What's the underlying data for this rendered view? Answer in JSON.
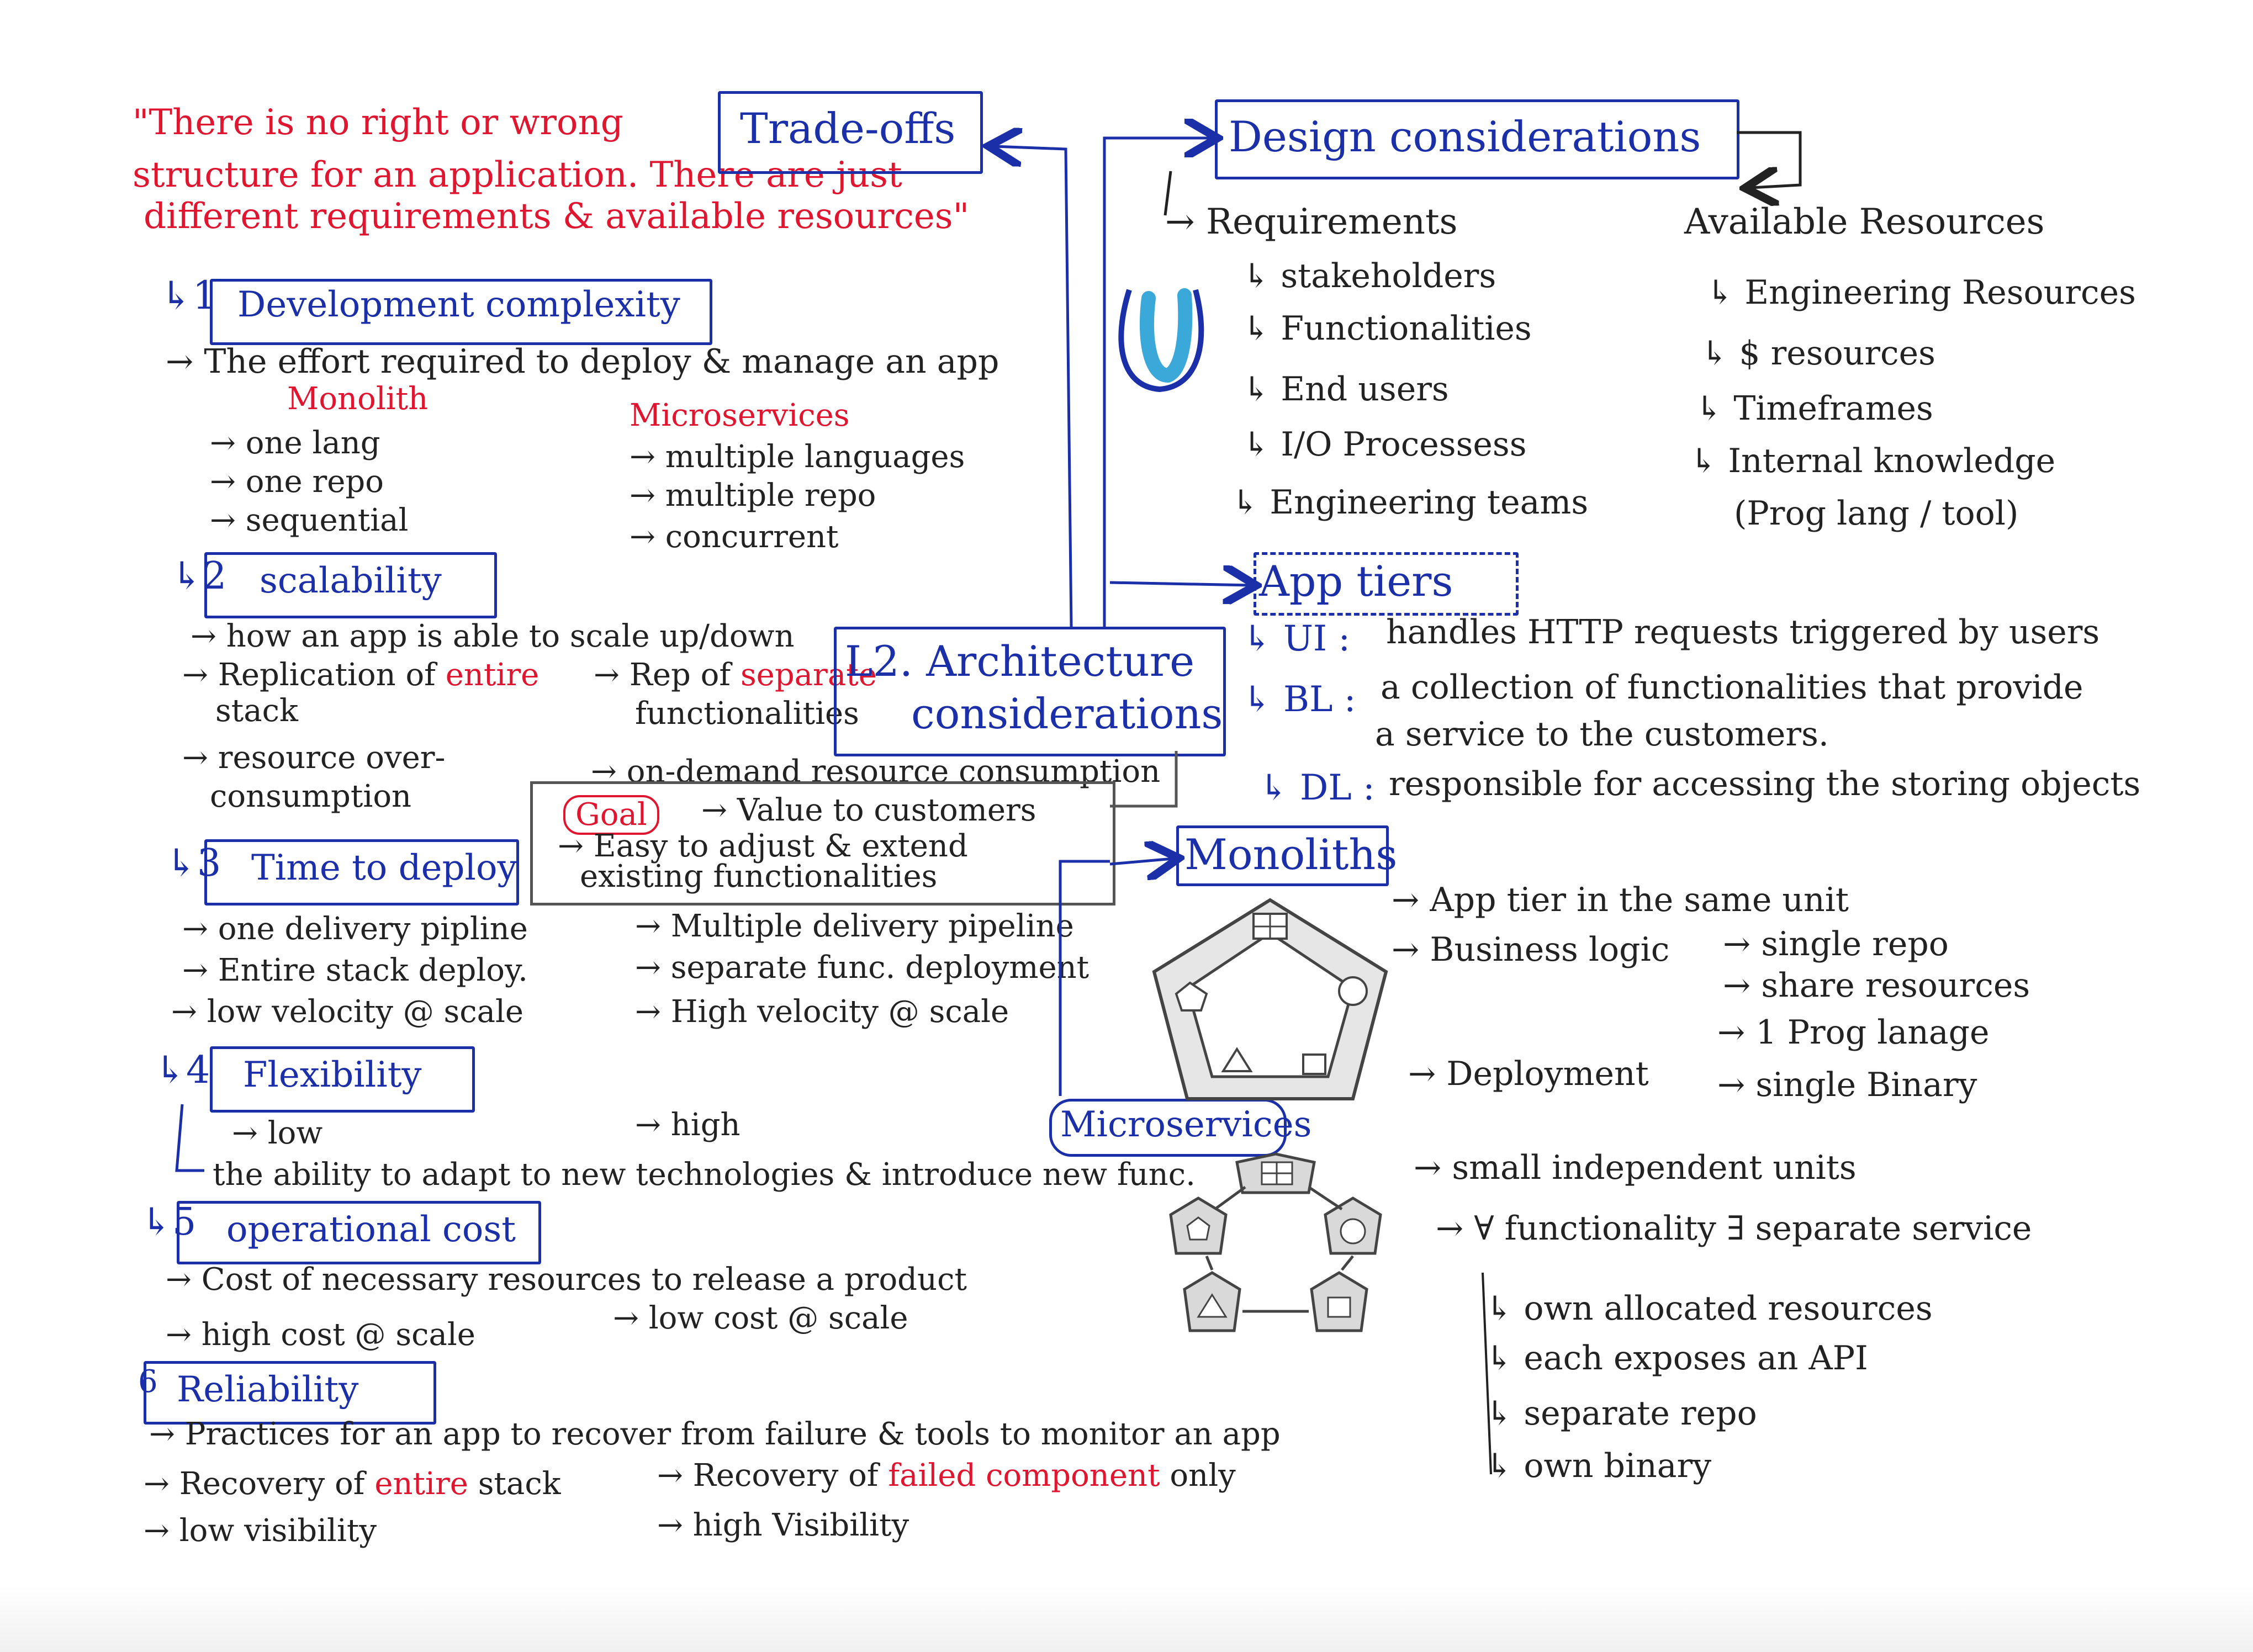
{
  "quote": {
    "line1": "\"There is no right or wrong",
    "line2": "structure for an application. There are just",
    "line3": "different requirements & available resources\""
  },
  "tradeoffs": {
    "label": "Trade-offs"
  },
  "center": {
    "line1": "L2. Architecture",
    "line2": "considerations"
  },
  "goal": {
    "label": "Goal",
    "item1": "→ Value to customers",
    "item2": "→ Easy to adjust & extend",
    "item3": "existing functionalities"
  },
  "dev_complexity": {
    "title": "Development complexity",
    "number": "1",
    "desc": "→ The effort required to deploy & manage an app",
    "monolith_head": "Monolith",
    "micro_head": "Microservices",
    "monolith": [
      "→ one lang",
      "→ one repo",
      "→ sequential"
    ],
    "micro": [
      "→ multiple languages",
      "→ multiple repo",
      "→ concurrent"
    ]
  },
  "scalability": {
    "title": "scalability",
    "number": "2",
    "desc": "→ how an app is able to scale up/down",
    "rep_left_1": "→ Replication of",
    "rep_left_red": "entire",
    "rep_left_2": "stack",
    "rep_right_1": "→ Rep of",
    "rep_right_red": "separate",
    "rep_right_2": "functionalities",
    "over_1": "→ resource over-",
    "over_2": "consumption",
    "ondemand": "→ on-demand resource consumption"
  },
  "time_to_deploy": {
    "title": "Time to deploy",
    "number": "3",
    "left": [
      "→ one delivery pipline",
      "→ Entire stack deploy.",
      "→ low velocity @ scale"
    ],
    "right": [
      "→ Multiple delivery pipeline",
      "→ separate func. deployment",
      "→ High velocity @ scale"
    ]
  },
  "flexibility": {
    "title": "Flexibility",
    "number": "4",
    "low": "→ low",
    "high": "→ high",
    "desc": "the ability to adapt to new technologies & introduce new func."
  },
  "operational_cost": {
    "title": "operational cost",
    "number": "5",
    "desc": "→ Cost of necessary resources to release a product",
    "left": "→ high cost @ scale",
    "right": "→ low cost @ scale"
  },
  "reliability": {
    "title": "Reliability",
    "number": "6",
    "desc": "→ Practices for an app to recover from failure & tools to monitor an app",
    "left1_a": "→ Recovery of",
    "left1_red": "entire",
    "left1_b": "stack",
    "right1_a": "→ Recovery of",
    "right1_red": "failed component",
    "right1_b": "only",
    "left2": "→ low visibility",
    "right2": "→ high Visibility"
  },
  "design": {
    "title": "Design considerations",
    "requirements": "→ Requirements",
    "req_items": [
      "↳ stakeholders",
      "↳ Functionalities",
      "↳ End users",
      "↳ I/O Processess",
      "↳ Engineering teams"
    ],
    "available": "Available Resources",
    "avail_items": [
      "↳ Engineering Resources",
      "↳ $ resources",
      "↳ Timeframes",
      "↳ Internal knowledge"
    ],
    "avail_note": "(Prog lang / tool)"
  },
  "app_tiers": {
    "title": "App tiers",
    "ui_label": "↳ UI :",
    "ui_text": "handles HTTP requests triggered by users",
    "bl_label": "↳ BL :",
    "bl_text1": "a collection of functionalities that provide",
    "bl_text2": "a service to the customers.",
    "dl_label": "↳ DL :",
    "dl_text": "responsible for accessing the storing objects"
  },
  "monoliths": {
    "title": "Monoliths",
    "items": [
      "→ App tier in the same unit",
      "→ Business logic"
    ],
    "logic": [
      "→ single repo",
      "→ share resources",
      "→ 1 Prog lanage",
      "→ single Binary"
    ],
    "deployment": "→ Deployment"
  },
  "microservices": {
    "title": "Microservices",
    "item1": "→ small independent units",
    "item2": "→ ∀ functionality ∃ separate service",
    "subs": [
      "↳ own allocated resources",
      "↳ each exposes an API",
      "↳ separate repo",
      "↳ own binary"
    ]
  },
  "colors": {
    "blue_ink": "#1a2fa8",
    "red_ink": "#e0152f",
    "black_ink": "#1c1c1c",
    "highlighter": "#3aa8d8"
  }
}
